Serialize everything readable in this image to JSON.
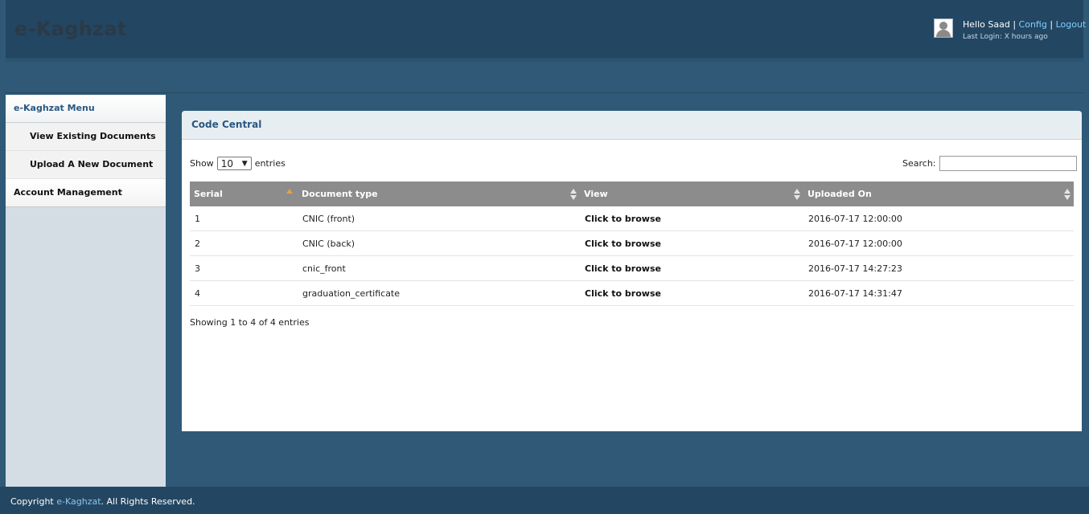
{
  "header": {
    "logo": "e-Kaghzat",
    "greeting": "Hello Saad",
    "config_label": "Config",
    "logout_label": "Logout",
    "separator": "|",
    "last_login": "Last Login: X hours ago"
  },
  "sidebar": {
    "menu_title": "e-Kaghzat Menu",
    "items": [
      {
        "label": "View Existing Documents"
      },
      {
        "label": "Upload A New Document"
      }
    ],
    "section": "Account Management"
  },
  "panel": {
    "title": "Code Central",
    "show_label": "Show",
    "entries_value": "10",
    "entries_label": "entries",
    "search_label": "Search:",
    "search_value": "",
    "columns": [
      "Serial",
      "Document type",
      "View",
      "Uploaded On"
    ],
    "rows": [
      {
        "serial": "1",
        "type": "CNIC (front)",
        "view": "Click to browse",
        "uploaded": "2016-07-17 12:00:00"
      },
      {
        "serial": "2",
        "type": "CNIC (back)",
        "view": "Click to browse",
        "uploaded": "2016-07-17 12:00:00"
      },
      {
        "serial": "3",
        "type": "cnic_front",
        "view": "Click to browse",
        "uploaded": "2016-07-17 14:27:23"
      },
      {
        "serial": "4",
        "type": "graduation_certificate",
        "view": "Click to browse",
        "uploaded": "2016-07-17 14:31:47"
      }
    ],
    "info": "Showing 1 to 4 of 4 entries"
  },
  "footer": {
    "prefix": "Copyright ",
    "brand": "e-Kaghzat",
    "suffix": ". All Rights Reserved."
  },
  "colors": {
    "page_bg": "#2f5977",
    "header_bg": "#234662",
    "accent_link": "#7fd0ff",
    "table_header": "#8c8c8c",
    "sort_active": "#e7a33a"
  }
}
